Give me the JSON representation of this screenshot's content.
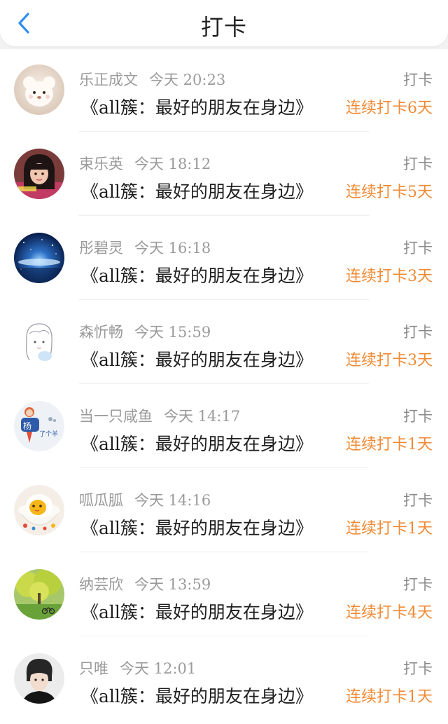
{
  "header": {
    "title": "打卡"
  },
  "colors": {
    "streak": "#f08a34",
    "meta": "#9a9a9a"
  },
  "rows": [
    {
      "name": "乐正成文",
      "time": "今天 20:23",
      "type": "打卡",
      "book": "《all簇：最好的朋友在身边》",
      "streak": "连续打卡6天",
      "avatar": "plush-bear-avatar"
    },
    {
      "name": "束乐英",
      "time": "今天 18:12",
      "type": "打卡",
      "book": "《all簇：最好的朋友在身边》",
      "streak": "连续打卡5天",
      "avatar": "girl-photo-avatar"
    },
    {
      "name": "彤碧灵",
      "time": "今天 16:18",
      "type": "打卡",
      "book": "《all簇：最好的朋友在身边》",
      "streak": "连续打卡3天",
      "avatar": "starry-sky-avatar"
    },
    {
      "name": "森忻畅",
      "time": "今天 15:59",
      "type": "打卡",
      "book": "《all簇：最好的朋友在身边》",
      "streak": "连续打卡3天",
      "avatar": "sketch-girl-avatar"
    },
    {
      "name": "当一只咸鱼",
      "time": "今天 14:17",
      "type": "打卡",
      "book": "《all簇：最好的朋友在身边》",
      "streak": "连续打卡1天",
      "avatar": "yang-figure-avatar"
    },
    {
      "name": "呱瓜胍",
      "time": "今天 14:16",
      "type": "打卡",
      "book": "《all簇：最好的朋友在身边》",
      "streak": "连续打卡1天",
      "avatar": "egg-bowl-avatar"
    },
    {
      "name": "纳芸欣",
      "time": "今天 13:59",
      "type": "打卡",
      "book": "《all簇：最好的朋友在身边》",
      "streak": "连续打卡4天",
      "avatar": "park-tree-avatar"
    },
    {
      "name": "只唯",
      "time": "今天 12:01",
      "type": "打卡",
      "book": "《all簇：最好的朋友在身边》",
      "streak": "连续打卡1天",
      "avatar": "boy-portrait-avatar"
    }
  ]
}
